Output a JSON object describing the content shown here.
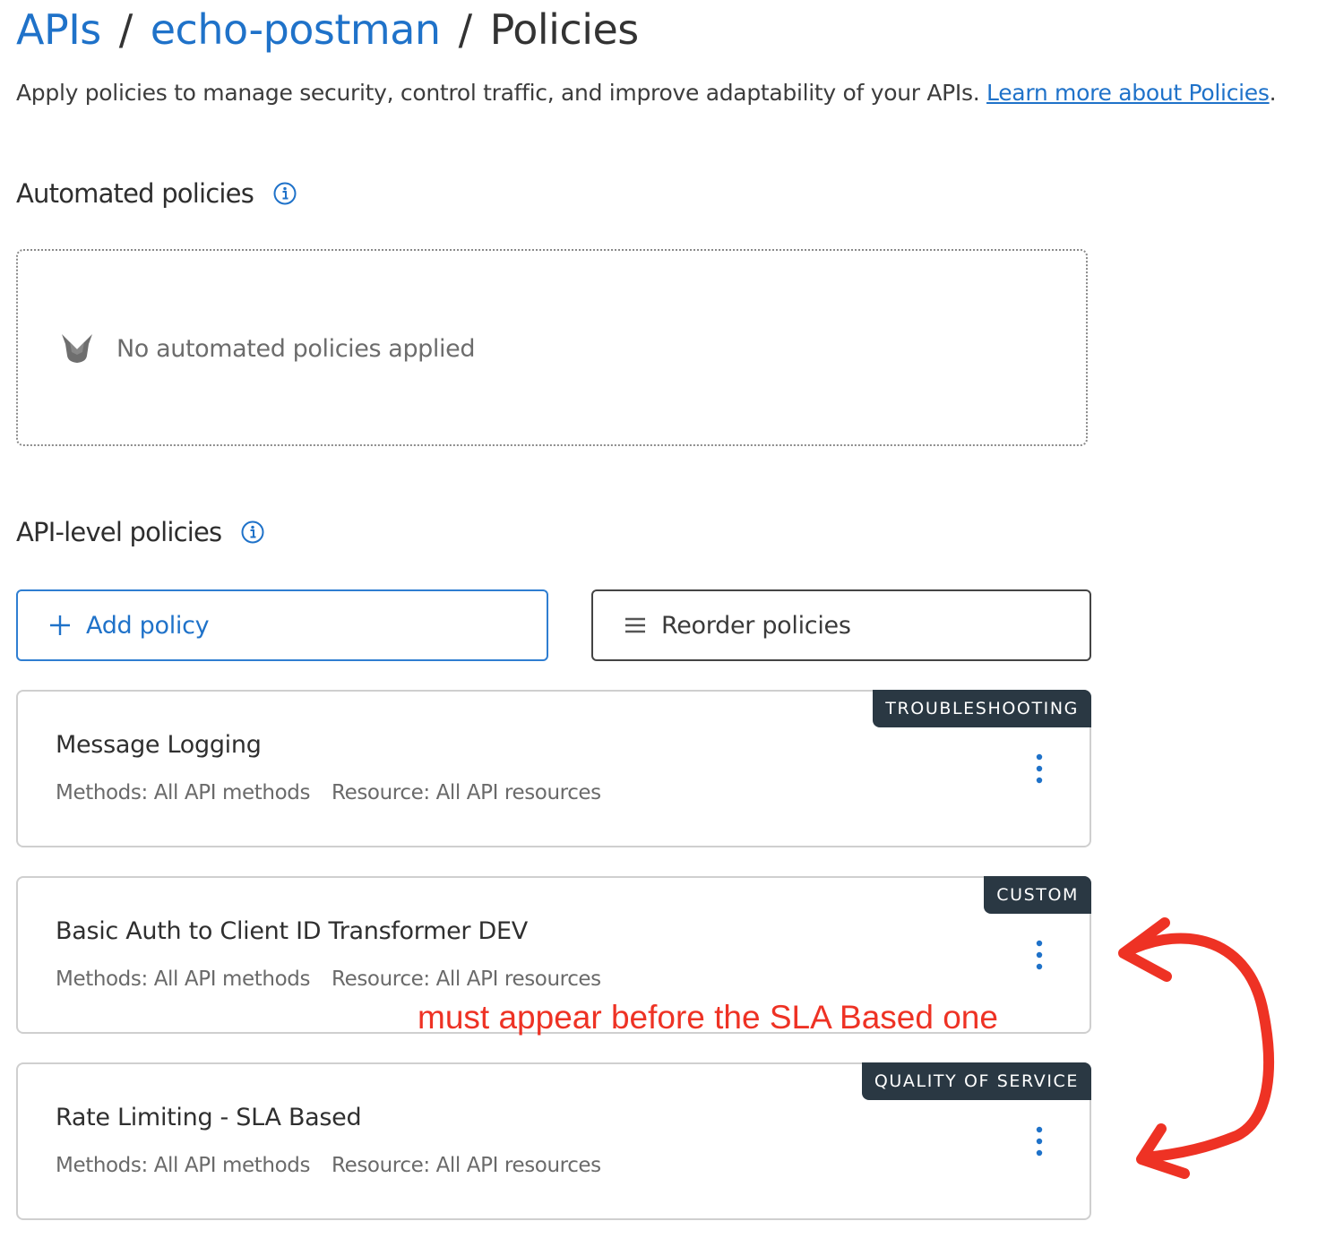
{
  "breadcrumb": {
    "items": [
      "APIs",
      "echo-postman"
    ],
    "separator": "/",
    "current": "Policies"
  },
  "intro": {
    "text": "Apply policies to manage security, control traffic, and improve adaptability of your APIs. ",
    "link_text": "Learn more about Policies",
    "trailing": "."
  },
  "automated": {
    "title": "Automated policies",
    "empty_text": "No automated policies applied"
  },
  "api_level": {
    "title": "API-level policies",
    "add_button": "Add policy",
    "reorder_button": "Reorder policies"
  },
  "policies": [
    {
      "name": "Message Logging",
      "tag": "TROUBLESHOOTING",
      "methods": "Methods: All API methods",
      "resource": "Resource: All API resources"
    },
    {
      "name": "Basic Auth to Client ID Transformer DEV",
      "tag": "CUSTOM",
      "methods": "Methods: All API methods",
      "resource": "Resource: All API resources"
    },
    {
      "name": "Rate Limiting - SLA Based",
      "tag": "QUALITY OF SERVICE",
      "methods": "Methods: All API methods",
      "resource": "Resource: All API resources"
    }
  ],
  "annotation": {
    "text": "must appear before the SLA Based one"
  },
  "colors": {
    "link_blue": "#1f72c9",
    "tag_bg": "#2a3843",
    "annotation_red": "#ee3224"
  },
  "icons": {
    "info": "info-circle-icon",
    "empty": "empty-state-icon",
    "add": "plus-icon",
    "reorder": "hamburger-icon",
    "menu": "kebab-menu-icon"
  }
}
